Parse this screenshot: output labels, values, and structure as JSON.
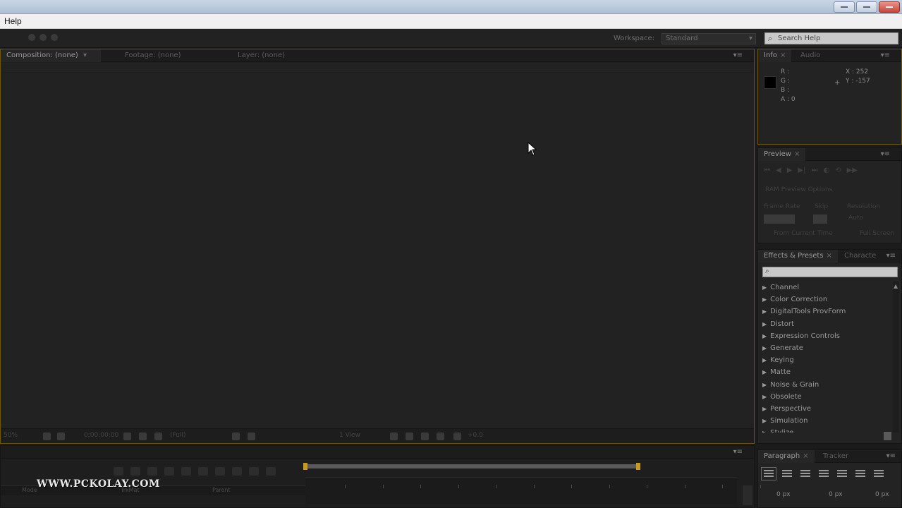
{
  "window": {
    "title": ""
  },
  "menubar": {
    "items": [
      "Help"
    ]
  },
  "toolbar": {
    "workspace_label": "Workspace:",
    "workspace_value": "Standard",
    "search_placeholder": "Search Help"
  },
  "composition_panel": {
    "tabs": [
      {
        "label": "Composition: (none)",
        "active": true
      },
      {
        "label": "Footage: (none)",
        "active": false
      },
      {
        "label": "Layer: (none)",
        "active": false
      }
    ],
    "bottom_bar": {
      "zoom": "50%",
      "timecode": "0;00;00;00",
      "resolution": "(Full)",
      "views": "1 View",
      "offset": "+0.0"
    }
  },
  "info_panel": {
    "tabs": [
      {
        "label": "Info",
        "active": true
      },
      {
        "label": "Audio",
        "active": false
      }
    ],
    "r": "R :",
    "g": "G :",
    "b": "B :",
    "a": "A : 0",
    "x": "X : 252",
    "y": "Y : -157",
    "swatch_color": "#000000"
  },
  "preview_panel": {
    "tabs": [
      {
        "label": "Preview",
        "active": true
      }
    ],
    "ram_options": "RAM Preview Options",
    "frame_rate_label": "Frame Rate",
    "skip_label": "Skip",
    "resolution_label": "Resolution",
    "resolution_value": "Auto",
    "from_current_time": "From Current Time",
    "full_screen": "Full Screen"
  },
  "effects_panel": {
    "tabs": [
      {
        "label": "Effects & Presets",
        "active": true
      },
      {
        "label": "Characte",
        "active": false
      }
    ],
    "categories": [
      "Channel",
      "Color Correction",
      "DigitalTools ProvForm",
      "Distort",
      "Expression Controls",
      "Generate",
      "Keying",
      "Matte",
      "Noise & Grain",
      "Obsolete",
      "Perspective",
      "Simulation",
      "Stylize"
    ]
  },
  "paragraph_panel": {
    "tabs": [
      {
        "label": "Paragraph",
        "active": true
      },
      {
        "label": "Tracker",
        "active": false
      }
    ],
    "indent_left": "0 px",
    "indent_right": "0 px",
    "indent_first": "0 px"
  },
  "timeline": {
    "col_mode": "Mode",
    "col_trkmat": "TrkMat",
    "col_parent": "Parent"
  },
  "watermark": "WWW.PCKOLAY.COM",
  "colors": {
    "panel_bg": "#232323",
    "focus_border": "#6b5416",
    "work_area": "#c79a1b",
    "menubar": "#f0f0f0"
  }
}
